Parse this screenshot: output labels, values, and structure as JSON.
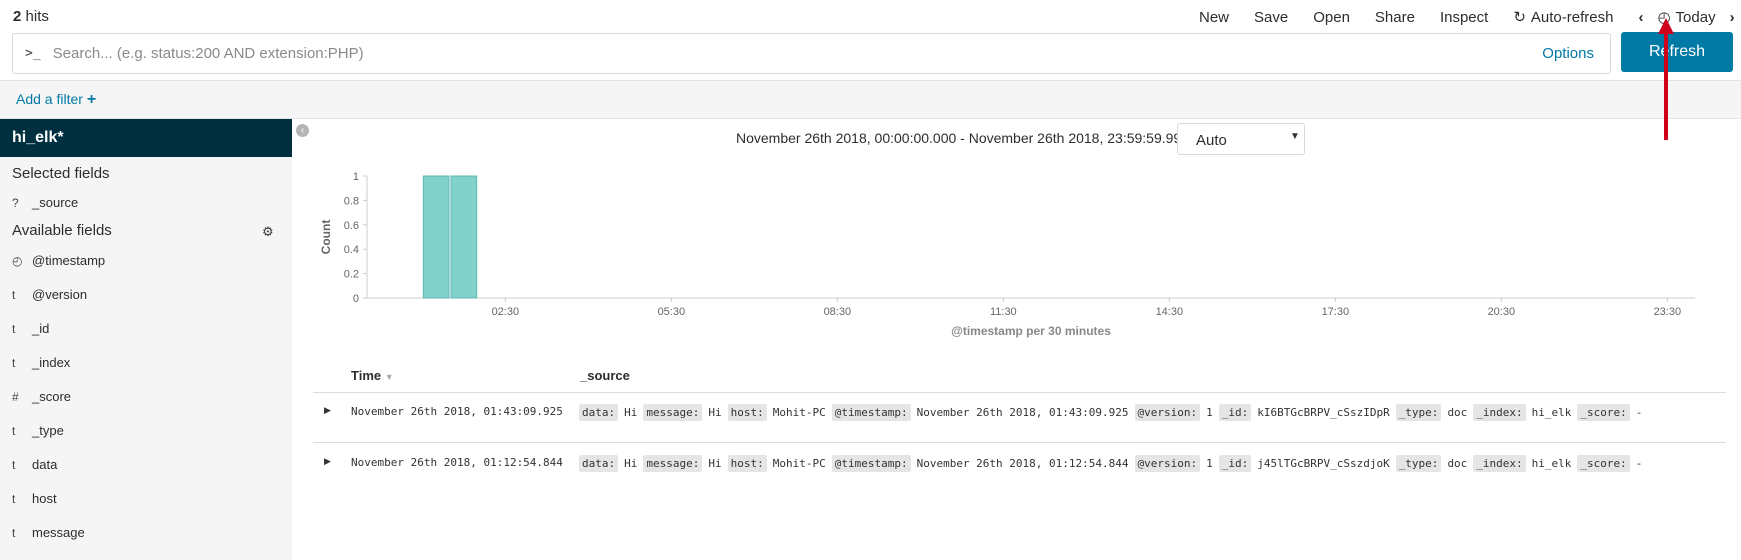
{
  "hits": {
    "count": "2",
    "label": "hits"
  },
  "topnav": {
    "items": [
      "New",
      "Save",
      "Open",
      "Share",
      "Inspect"
    ],
    "autorefresh": "Auto-refresh",
    "today": "Today"
  },
  "search": {
    "prompt": ">_",
    "placeholder": "Search... (e.g. status:200 AND extension:PHP)",
    "options": "Options",
    "refresh": "Refresh"
  },
  "filter": {
    "add": "Add a filter"
  },
  "sidebar": {
    "index": "hi_elk*",
    "selected_title": "Selected fields",
    "selected": [
      {
        "type": "?",
        "name": "_source"
      }
    ],
    "available_title": "Available fields",
    "available": [
      {
        "type": "clock",
        "name": "@timestamp"
      },
      {
        "type": "t",
        "name": "@version"
      },
      {
        "type": "t",
        "name": "_id"
      },
      {
        "type": "t",
        "name": "_index"
      },
      {
        "type": "#",
        "name": "_score"
      },
      {
        "type": "t",
        "name": "_type"
      },
      {
        "type": "t",
        "name": "data"
      },
      {
        "type": "t",
        "name": "host"
      },
      {
        "type": "t",
        "name": "message"
      }
    ]
  },
  "timerange": {
    "text": "November 26th 2018, 00:00:00.000 - November 26th 2018, 23:59:59.999 —",
    "interval": "Auto"
  },
  "chart_data": {
    "type": "bar",
    "ylabel": "Count",
    "xlabel": "@timestamp per 30 minutes",
    "ylim": [
      0,
      1
    ],
    "yticks": [
      "0",
      "0.2",
      "0.4",
      "0.6",
      "0.8",
      "1"
    ],
    "xticks": [
      "02:30",
      "05:30",
      "08:30",
      "11:30",
      "14:30",
      "17:30",
      "20:30",
      "23:30"
    ],
    "xtick_hours": [
      2.5,
      5.5,
      8.5,
      11.5,
      14.5,
      17.5,
      20.5,
      23.5
    ],
    "x_range_hours": [
      0,
      24
    ],
    "bars": [
      {
        "start_hour": 1.0,
        "end_hour": 1.5,
        "value": 1
      },
      {
        "start_hour": 1.5,
        "end_hour": 2.0,
        "value": 1
      }
    ],
    "bar_color": "#82d1cb",
    "grid": false
  },
  "table": {
    "headers": {
      "time": "Time",
      "source": "_source"
    },
    "rows": [
      {
        "time": "November 26th 2018, 01:43:09.925",
        "source": [
          [
            "data:",
            "Hi"
          ],
          [
            "message:",
            "Hi"
          ],
          [
            "host:",
            "Mohit-PC"
          ],
          [
            "@timestamp:",
            "November 26th 2018, 01:43:09.925"
          ],
          [
            "@version:",
            "1"
          ],
          [
            "_id:",
            "kI6BTGcBRPV_cSszIDpR"
          ],
          [
            "_type:",
            "doc"
          ],
          [
            "_index:",
            "hi_elk"
          ],
          [
            "_score:",
            "-"
          ]
        ]
      },
      {
        "time": "November 26th 2018, 01:12:54.844",
        "source": [
          [
            "data:",
            "Hi"
          ],
          [
            "message:",
            "Hi"
          ],
          [
            "host:",
            "Mohit-PC"
          ],
          [
            "@timestamp:",
            "November 26th 2018, 01:12:54.844"
          ],
          [
            "@version:",
            "1"
          ],
          [
            "_id:",
            "j45lTGcBRPV_cSszdjoK"
          ],
          [
            "_type:",
            "doc"
          ],
          [
            "_index:",
            "hi_elk"
          ],
          [
            "_score:",
            "-"
          ]
        ]
      }
    ]
  },
  "colors": {
    "accent": "#0079a5",
    "header_dark": "#002f3f",
    "annotation": "#d0021b"
  }
}
